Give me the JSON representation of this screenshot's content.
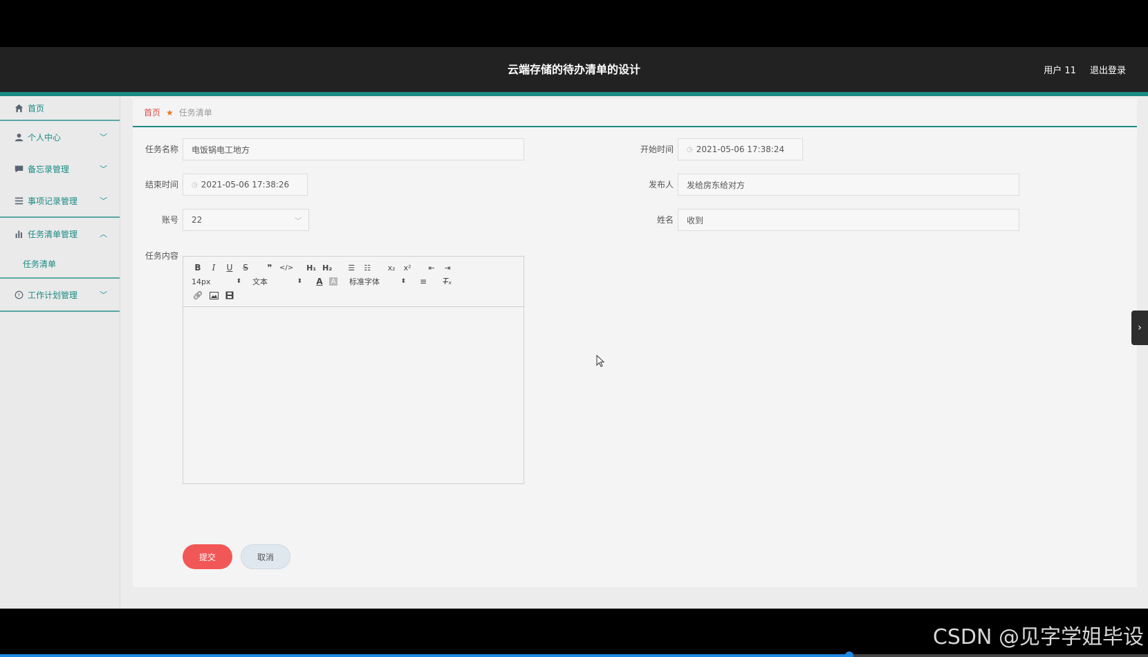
{
  "header": {
    "title": "云端存储的待办清单的设计",
    "user_label": "用户 11",
    "logout_label": "退出登录"
  },
  "sidebar": {
    "items": [
      {
        "label": "首页",
        "icon": "home-icon"
      },
      {
        "label": "个人中心",
        "icon": "user-icon"
      },
      {
        "label": "备忘录管理",
        "icon": "chat-icon"
      },
      {
        "label": "事项记录管理",
        "icon": "list-icon"
      },
      {
        "label": "任务清单管理",
        "icon": "bar-chart-icon"
      },
      {
        "label": "工作计划管理",
        "icon": "help-icon"
      }
    ],
    "sub_items": [
      {
        "label": "任务清单"
      }
    ]
  },
  "breadcrumb": {
    "home": "首页",
    "current": "任务清单"
  },
  "form": {
    "task_name_label": "任务名称",
    "task_name_value": "电饭锅电工地方",
    "start_time_label": "开始时间",
    "start_time_value": "2021-05-06 17:38:24",
    "end_time_label": "结束时间",
    "end_time_value": "2021-05-06 17:38:26",
    "publisher_label": "发布人",
    "publisher_value": "发给房东给对方",
    "account_label": "账号",
    "account_value": "22",
    "name_label": "姓名",
    "name_value": "收到",
    "content_label": "任务内容"
  },
  "editor": {
    "font_size": "14px",
    "text_type": "文本",
    "font_family": "标准字体"
  },
  "buttons": {
    "submit": "提交",
    "cancel": "取消"
  },
  "watermark": "CSDN @见字学姐毕设",
  "video_progress": 0.74,
  "colors": {
    "accent": "#1a8a84",
    "submit": "#f25757",
    "header_bg": "#222222"
  }
}
